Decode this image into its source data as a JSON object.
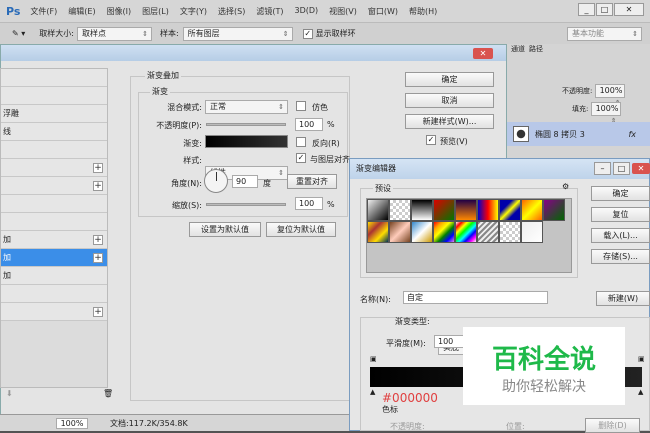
{
  "menubar": {
    "logo": "Ps",
    "items": [
      "文件(F)",
      "编辑(E)",
      "图像(I)",
      "图层(L)",
      "文字(Y)",
      "选择(S)",
      "滤镜(T)",
      "3D(D)",
      "视图(V)",
      "窗口(W)",
      "帮助(H)"
    ]
  },
  "options": {
    "sample_size_label": "取样大小:",
    "sample_size": "取样点",
    "sample_label": "样本:",
    "sample": "所有图层",
    "show_ring": "显示取样环",
    "workspace": "基本功能"
  },
  "layers_panel": {
    "tabs": [
      "通道",
      "路径"
    ],
    "opacity_label": "不透明度:",
    "opacity": "100%",
    "fill_label": "填充:",
    "fill": "100%",
    "layer_name": "椭圆 8 拷贝 3",
    "fx": "fx"
  },
  "layer_style": {
    "list": [
      {
        "t": ""
      },
      {
        "t": ""
      },
      {
        "t": "浮雕"
      },
      {
        "t": "线"
      },
      {
        "t": ""
      },
      {
        "t": "",
        "plus": true
      },
      {
        "t": "",
        "plus": true
      },
      {
        "t": ""
      },
      {
        "t": ""
      },
      {
        "t": "加",
        "plus": true
      },
      {
        "t": "加",
        "plus": true,
        "on": true
      },
      {
        "t": "加"
      },
      {
        "t": ""
      },
      {
        "t": "",
        "plus": true
      }
    ],
    "section": "渐变叠加",
    "group": "渐变",
    "blend_label": "混合模式:",
    "blend": "正常",
    "dither": "仿色",
    "opacity_label": "不透明度(P):",
    "opacity": "100",
    "pct": "%",
    "gradient_label": "渐变:",
    "reverse": "反向(R)",
    "style_label": "样式:",
    "style": "线性",
    "align": "与图层对齐",
    "angle_label": "角度(N):",
    "angle": "90",
    "deg": "度",
    "reset_align": "重置对齐",
    "scale_label": "缩放(S):",
    "scale": "100",
    "set_default": "设置为默认值",
    "reset_default": "复位为默认值",
    "ok": "确定",
    "cancel": "取消",
    "new_style": "新建样式(W)...",
    "preview": "预览(V)"
  },
  "gradient_editor": {
    "title": "渐变编辑器",
    "presets": "预设",
    "ok": "确定",
    "reset": "复位",
    "load": "载入(L)...",
    "save": "存储(S)...",
    "name_label": "名称(N):",
    "name": "自定",
    "new": "新建(W)",
    "type_label": "渐变类型:",
    "type": "实底",
    "smooth_label": "平滑度(M):",
    "smooth": "100",
    "color_hex": "#000000",
    "stops_label": "色标",
    "stop_opacity": "不透明度:",
    "pos": "位置:",
    "delete": "删除(D)",
    "swatches": [
      "linear-gradient(135deg,#eee,#000)",
      "repeating-conic-gradient(#ccc 0 25%,#fff 0 50%) 0 0/6px 6px",
      "linear-gradient(#000,#fff)",
      "linear-gradient(135deg,#d00,#070)",
      "linear-gradient(#204,#f80)",
      "linear-gradient(90deg,#00c,#f00,#ff0)",
      "linear-gradient(135deg,#00a 30%,#ff0 50%,#00a 70%)",
      "linear-gradient(135deg,#f60,#ff0,#f60)",
      "linear-gradient(135deg,#808,#060)",
      "linear-gradient(135deg,#fd0,#a33,#fd0,#035)",
      "linear-gradient(135deg,#742,#fcb,#742)",
      "linear-gradient(135deg,#38c,#fff,#c90)",
      "linear-gradient(135deg,red,orange,yellow,green,blue,violet)",
      "linear-gradient(135deg,#fff,red,yellow,lime,cyan,blue,magenta,#fff)",
      "repeating-linear-gradient(135deg,#888 0 2px,#eee 2px 4px)",
      "repeating-conic-gradient(#ccc 0 25%,#fff 0 50%) 0 0/6px 6px",
      "linear-gradient(135deg,#eee,#fff)"
    ]
  },
  "status": {
    "zoom": "100%",
    "doc": "文档:117.2K/354.8K"
  },
  "watermark": {
    "title": "百科全说",
    "sub": "助你轻松解决"
  }
}
